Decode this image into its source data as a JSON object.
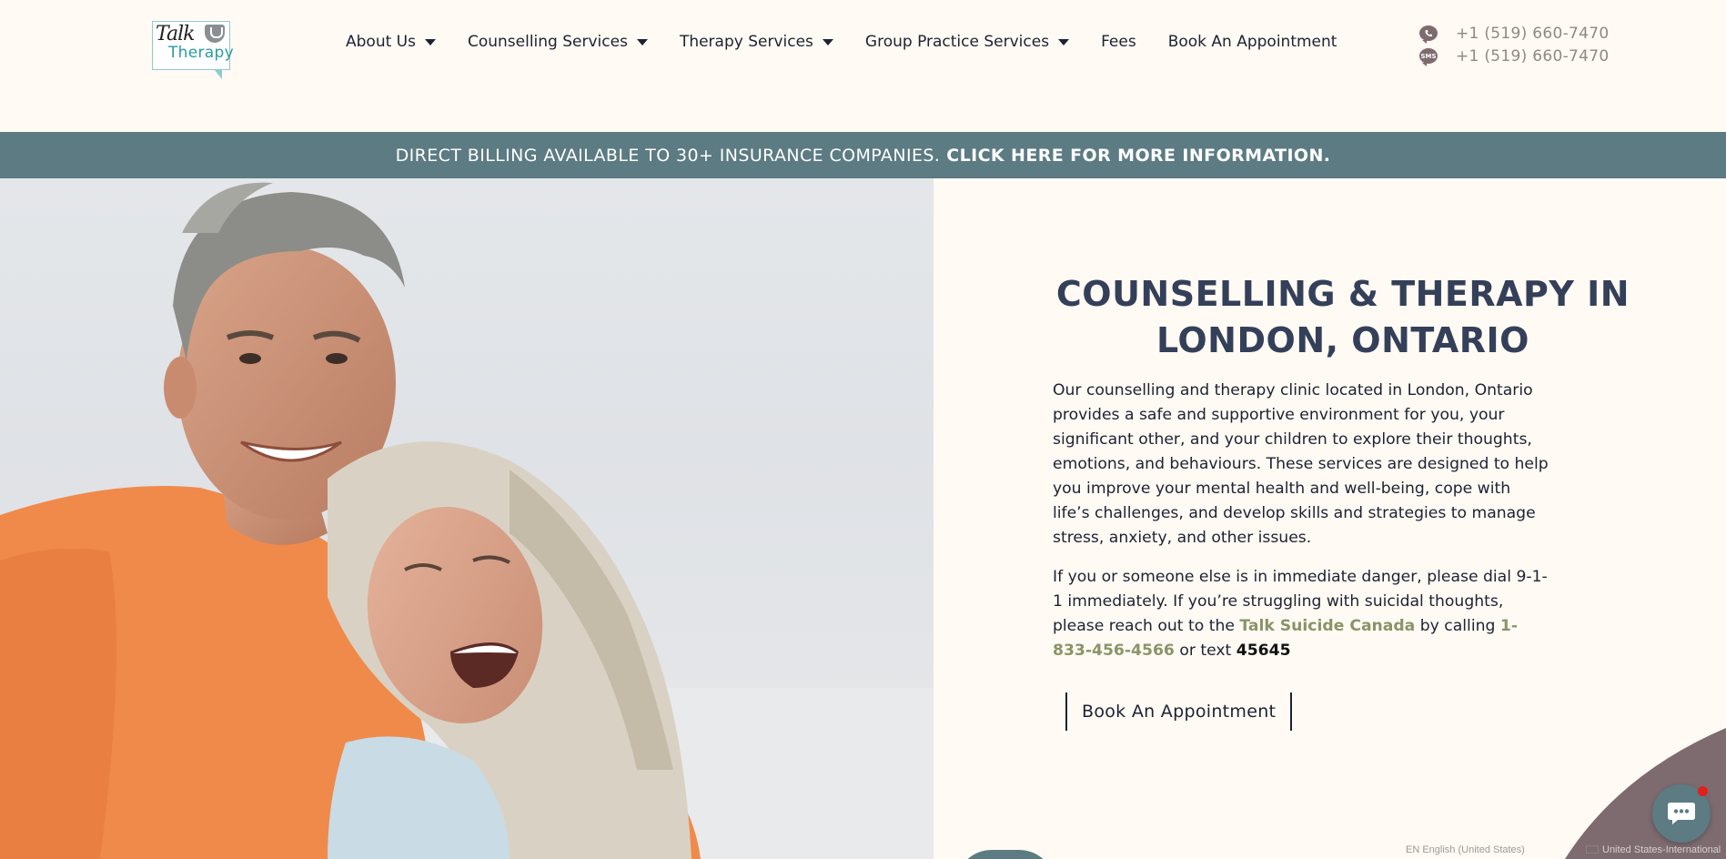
{
  "logo": {
    "line1": "Talk",
    "line2": "Therapy"
  },
  "nav": {
    "items": [
      {
        "label": "About Us",
        "dropdown": true
      },
      {
        "label": "Counselling Services",
        "dropdown": true
      },
      {
        "label": "Therapy Services",
        "dropdown": true
      },
      {
        "label": "Group Practice Services",
        "dropdown": true
      },
      {
        "label": "Fees",
        "dropdown": false
      },
      {
        "label": "Book An Appointment",
        "dropdown": false
      }
    ]
  },
  "contact": {
    "phone": {
      "icon": "phone-icon",
      "text": "+1 (519) 660-7470"
    },
    "sms": {
      "icon": "sms-icon",
      "icon_text": "SMS",
      "text": "+1 (519) 660-7470"
    }
  },
  "banner": {
    "text": "DIRECT BILLING AVAILABLE TO 30+ INSURANCE COMPANIES.",
    "link": "CLICK HERE FOR MORE INFORMATION."
  },
  "hero": {
    "title": "COUNSELLING & THERAPY IN LONDON, ONTARIO",
    "paragraph1": "Our counselling and therapy clinic located in London, Ontario provides a safe and supportive environment for you, your significant other, and your children to explore their thoughts, emotions, and behaviours. These services are designed to help you improve your mental health and well-being, cope with life’s challenges, and develop skills and strategies to manage stress, anxiety, and other issues.",
    "paragraph2": {
      "before": "If you or someone else is in immediate danger, please dial 9-1-1 immediately. If you’re struggling with suicidal thoughts, please reach out to the ",
      "link_org": "Talk Suicide Canada",
      "middle": " by calling ",
      "link_phone": "1-833-456-4566",
      "after": " or text ",
      "text_number": "45645"
    },
    "button": "Book An Appointment"
  },
  "language_bar": {
    "left": "EN English (United States)",
    "right": "United States-International"
  },
  "colors": {
    "background": "#fffaf3",
    "banner": "#5c7b83",
    "title": "#344059",
    "link_green": "#8a9468",
    "accent_mauve": "#7d6b70",
    "chat_badge": "#e0201b"
  }
}
